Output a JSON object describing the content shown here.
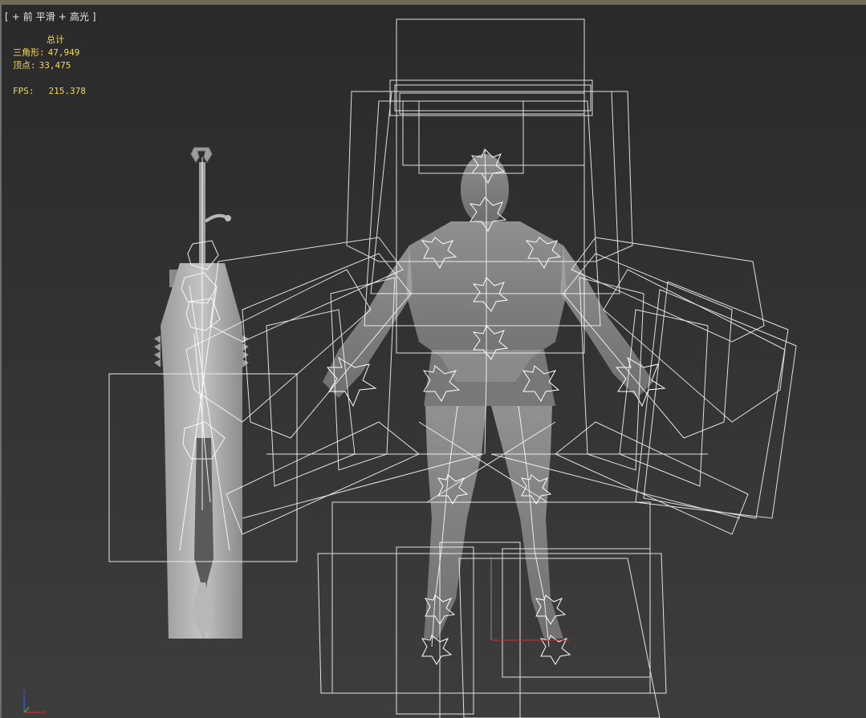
{
  "viewport": {
    "label": {
      "open_bracket": "[",
      "plus": "+",
      "view": "前",
      "shading": "平滑",
      "highlight_plus": "+",
      "highlight": "高光",
      "close_bracket": "]"
    },
    "stats": {
      "total_label": "总计",
      "triangles_label": "三角形:",
      "triangles_value": "47,949",
      "vertices_label": "顶点:",
      "vertices_value": "33,475",
      "fps_label": "FPS:",
      "fps_value": "215.378"
    },
    "axis": {
      "z": "z",
      "x": "x"
    },
    "colors": {
      "stats_text": "#f2d75a",
      "wireframe": "#ffffff",
      "mesh": "#a8a8a8",
      "axis_x": "#d22b2b",
      "axis_y": "#2bd22b",
      "axis_z": "#3b5bff"
    }
  }
}
